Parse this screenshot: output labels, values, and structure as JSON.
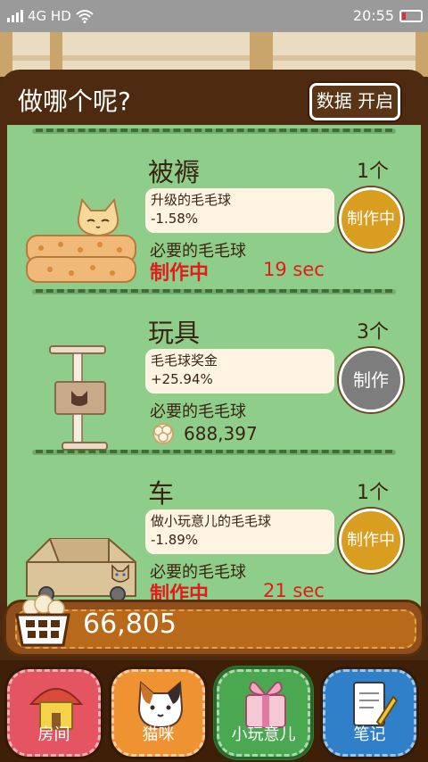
{
  "status_bar": {
    "network": "4G HD",
    "time": "20:55"
  },
  "panel": {
    "title": "做哪个呢?",
    "data_button": "数据 开启"
  },
  "items": [
    {
      "name": "被褥",
      "count": "1个",
      "effect_label": "升级的毛毛球",
      "effect_value": "-1.58%",
      "need_label": "必要的毛毛球",
      "status": "制作中",
      "time_left": "19 sec",
      "button": "制作中",
      "button_state": "busy",
      "art": "bedding-icon"
    },
    {
      "name": "玩具",
      "count": "3个",
      "effect_label": "毛毛球奖金",
      "effect_value": "+25.94%",
      "need_label": "必要的毛毛球",
      "cost": "688,397",
      "button": "制作",
      "button_state": "idle",
      "art": "cat-tower-icon"
    },
    {
      "name": "车",
      "count": "1个",
      "effect_label": "做小玩意儿的毛毛球",
      "effect_value": "-1.89%",
      "need_label": "必要的毛毛球",
      "status": "制作中",
      "time_left": "21 sec",
      "button": "制作中",
      "button_state": "busy",
      "art": "cardboard-car-icon"
    }
  ],
  "currency": {
    "value": "66,805",
    "icon": "yarn-basket-icon"
  },
  "nav": [
    {
      "label": "房间",
      "icon": "house-icon",
      "color": "#e45461"
    },
    {
      "label": "猫咪",
      "icon": "cat-face-icon",
      "color": "#ef9231"
    },
    {
      "label": "小玩意儿",
      "icon": "gift-box-icon",
      "color": "#4aa850"
    },
    {
      "label": "笔记",
      "icon": "notepad-icon",
      "color": "#2f7fc9"
    }
  ],
  "colors": {
    "busy_button": "#d99e1f",
    "idle_button": "#7d7d7d",
    "status_red": "#e31b1b",
    "list_bg": "#8fce8a"
  }
}
